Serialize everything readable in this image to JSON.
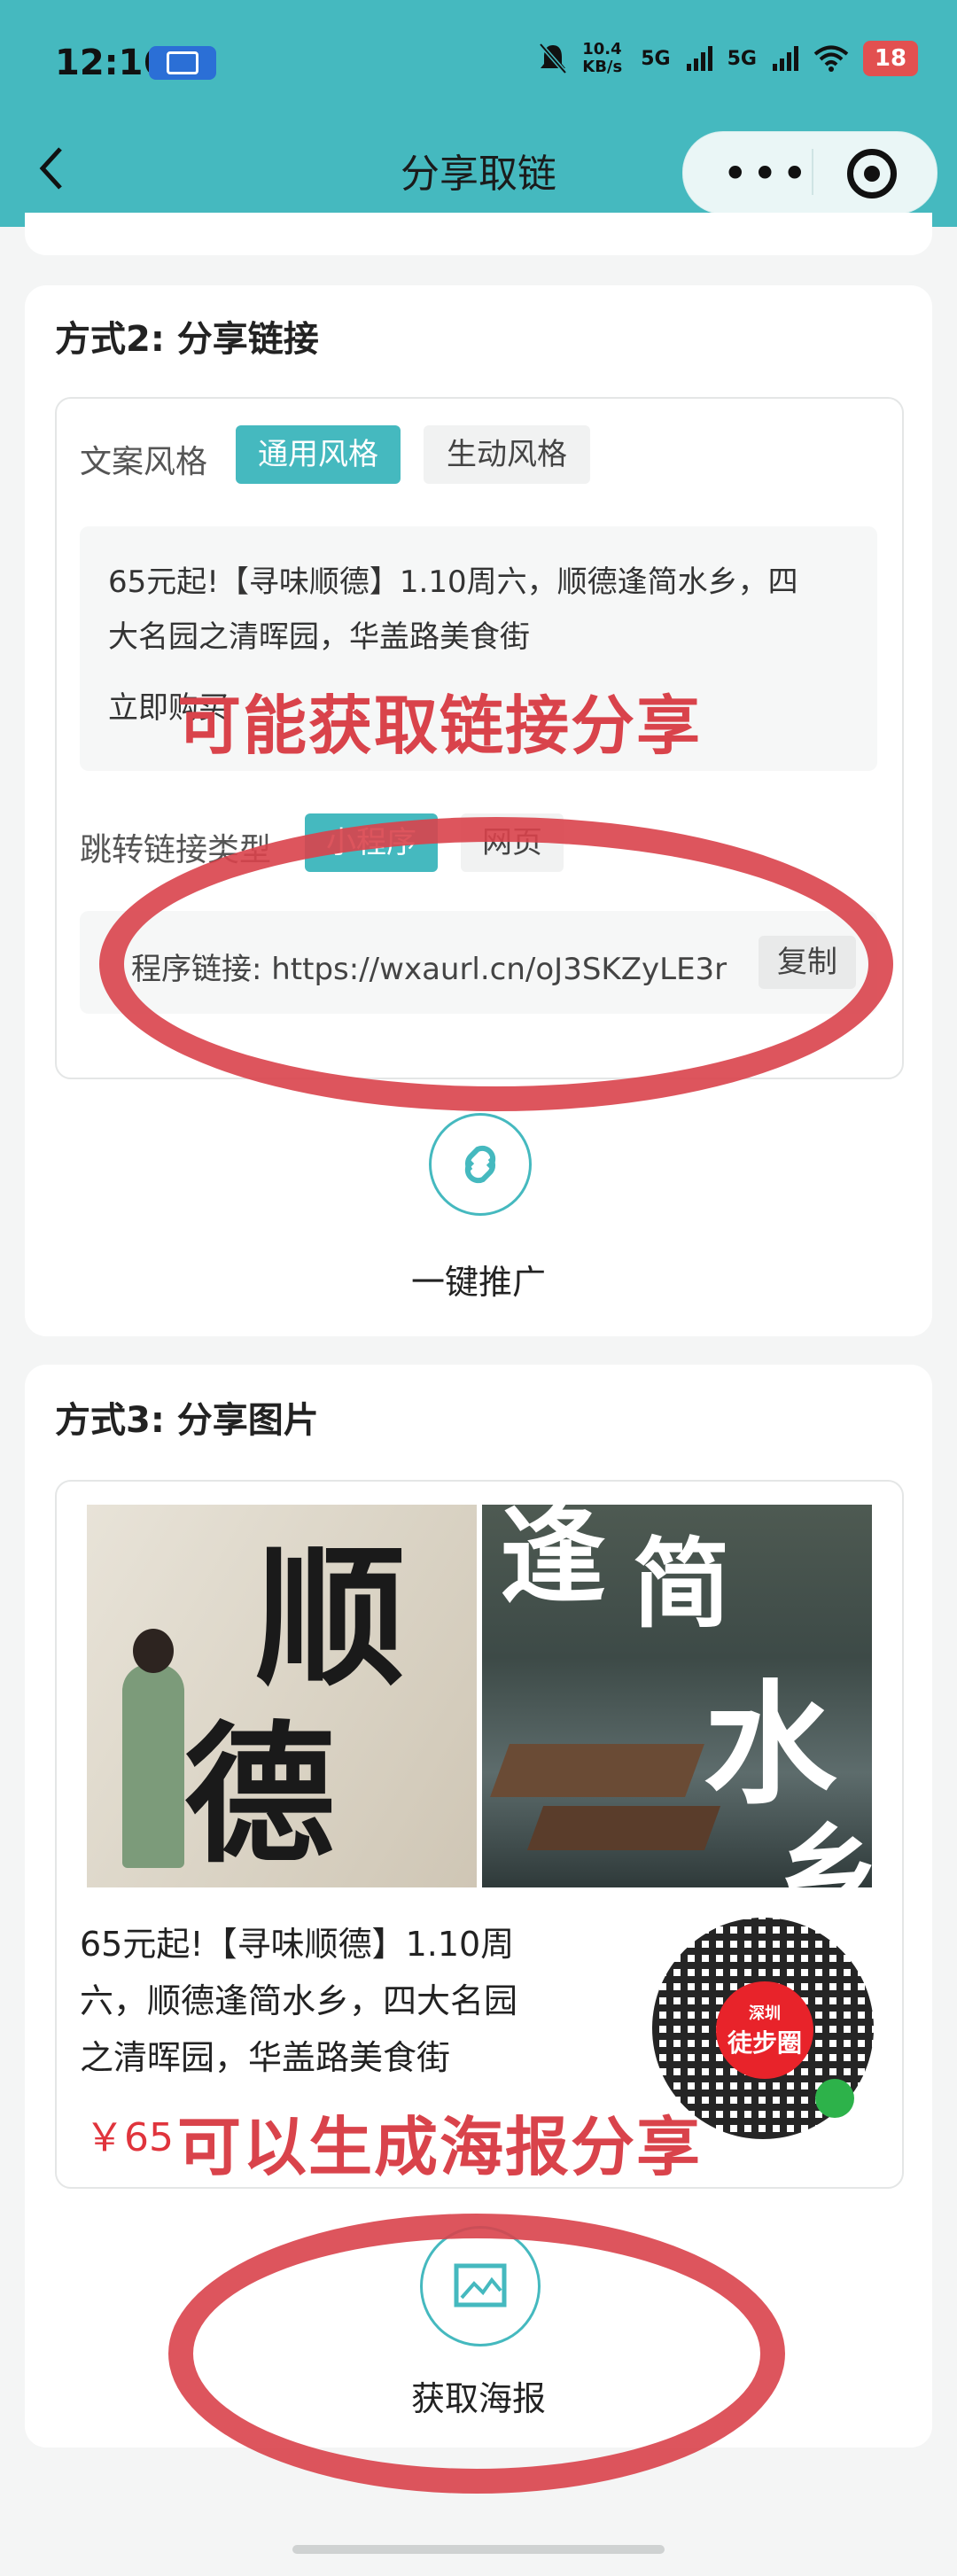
{
  "status_bar": {
    "time": "12:16",
    "net_speed": "10.4 KB/s",
    "signal1": "5G",
    "signal2": "5G",
    "battery": "18"
  },
  "nav": {
    "title": "分享取链",
    "more_icon": "more-dots-icon",
    "close_icon": "target-ring-icon"
  },
  "method2": {
    "title": "方式2: 分享链接",
    "style_label": "文案风格",
    "style_options": [
      "通用风格",
      "生动风格"
    ],
    "copy_text_line1": "65元起!【寻味顺德】1.10周六，顺德逢简水乡，四",
    "copy_text_line2": "大名园之清晖园，华盖路美食街",
    "copy_text_line3": "立即购买",
    "link_type_label": "跳转链接类型",
    "link_type_options": [
      "小程序",
      "网页"
    ],
    "link_text": "程序链接: https://wxaurl.cn/oJ3SKZyLE3r",
    "copy_button": "复制",
    "promote_label": "一键推广",
    "overlay_note": "可能获取链接分享"
  },
  "method3": {
    "title": "方式3: 分享图片",
    "poster_chars_left": [
      "顺",
      "德"
    ],
    "poster_chars_right": [
      "逢",
      "简",
      "水",
      "乡"
    ],
    "poster_desc_line1": "65元起!【寻味顺德】1.10周",
    "poster_desc_line2": "六，顺德逢简水乡，四大名园",
    "poster_desc_line3": "之清晖园，华盖路美食街",
    "price": "￥65",
    "qr_brand": "徒步圈",
    "qr_city": "深圳",
    "get_poster_label": "获取海报",
    "overlay_note": "可以生成海报分享"
  },
  "colors": {
    "accent": "#45b9bf",
    "overlay_red": "#d9434b",
    "price_red": "#e0343c"
  }
}
